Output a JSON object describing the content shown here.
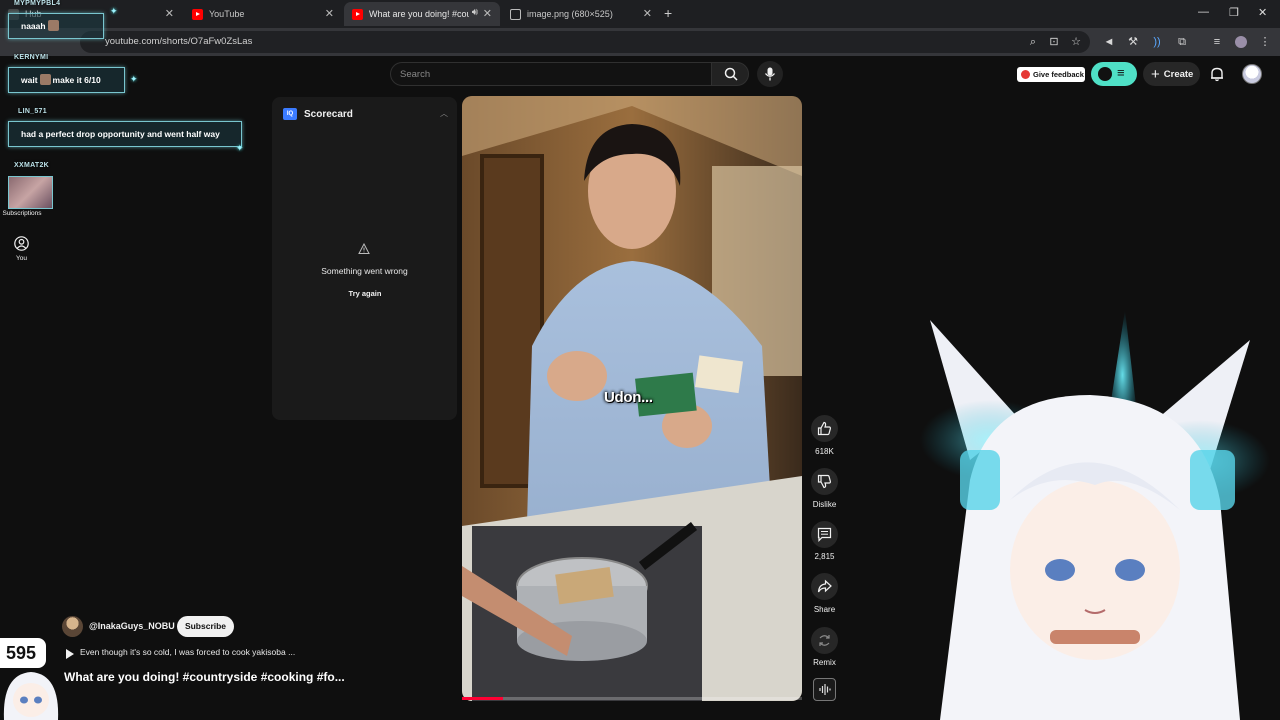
{
  "browser": {
    "tabs": [
      {
        "label": "Hub",
        "favicon": "hub-favicon"
      },
      {
        "label": "YouTube",
        "favicon": "youtube-favicon"
      },
      {
        "label": "What are you doing! #coun",
        "favicon": "youtube-favicon",
        "active": true
      },
      {
        "label": "image.png (680×525)",
        "favicon": "globe-favicon"
      }
    ],
    "url": "youtube.com/shorts/O7aFw0ZsLas"
  },
  "header": {
    "search_placeholder": "Search",
    "feedback_label": "Give feedback",
    "create_label": "Create"
  },
  "sidebar": {
    "subscriptions_label": "Subscriptions",
    "you_label": "You"
  },
  "scorecard": {
    "title": "Scorecard",
    "error_message": "Something went wrong",
    "retry_label": "Try again"
  },
  "video": {
    "caption": "Udon...",
    "progress": 0.12
  },
  "actions": {
    "like_count": "618K",
    "dislike_label": "Dislike",
    "comment_count": "2,815",
    "share_label": "Share",
    "remix_label": "Remix"
  },
  "channel": {
    "name": "@InakaGuys_NOBU",
    "subscribe_label": "Subscribe",
    "description": "Even though it's so cold, I was forced to cook yakisoba ...",
    "title": "What are you doing! #countryside #cooking #fo..."
  },
  "chat": [
    {
      "user": "MYPMYPBL4",
      "message": "naaah"
    },
    {
      "user": "KERNYMI",
      "message_a": "wait",
      "message_b": "make it 6/10"
    },
    {
      "user": "LIN_571",
      "message": "had a perfect drop opportunity and went half way"
    },
    {
      "user": "XXMAT2K",
      "message": ""
    }
  ],
  "stream_counter": "595",
  "colors": {
    "accent": "#ff0033",
    "chat_border": "#79c6cf",
    "extension_teal": "#4fe0c6",
    "background": "#0f0f0f"
  }
}
